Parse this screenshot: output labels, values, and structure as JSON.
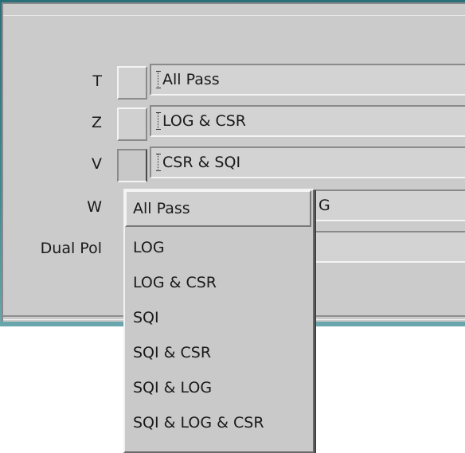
{
  "rows": [
    {
      "label": "T",
      "value": "All Pass"
    },
    {
      "label": "Z",
      "value": "LOG & CSR"
    },
    {
      "label": "V",
      "value": "CSR & SQI"
    },
    {
      "label": "W",
      "value_suffix": "G"
    },
    {
      "label": "Dual Pol",
      "value": ""
    }
  ],
  "dropdown": {
    "selected": "All Pass",
    "options": [
      "LOG",
      "LOG & CSR",
      "SQI",
      "SQI & CSR",
      "SQI & LOG",
      "SQI & LOG & CSR"
    ]
  },
  "colors": {
    "panel": "#cbcbcb",
    "field": "#d3d3d3",
    "text": "#1a1a1a"
  }
}
